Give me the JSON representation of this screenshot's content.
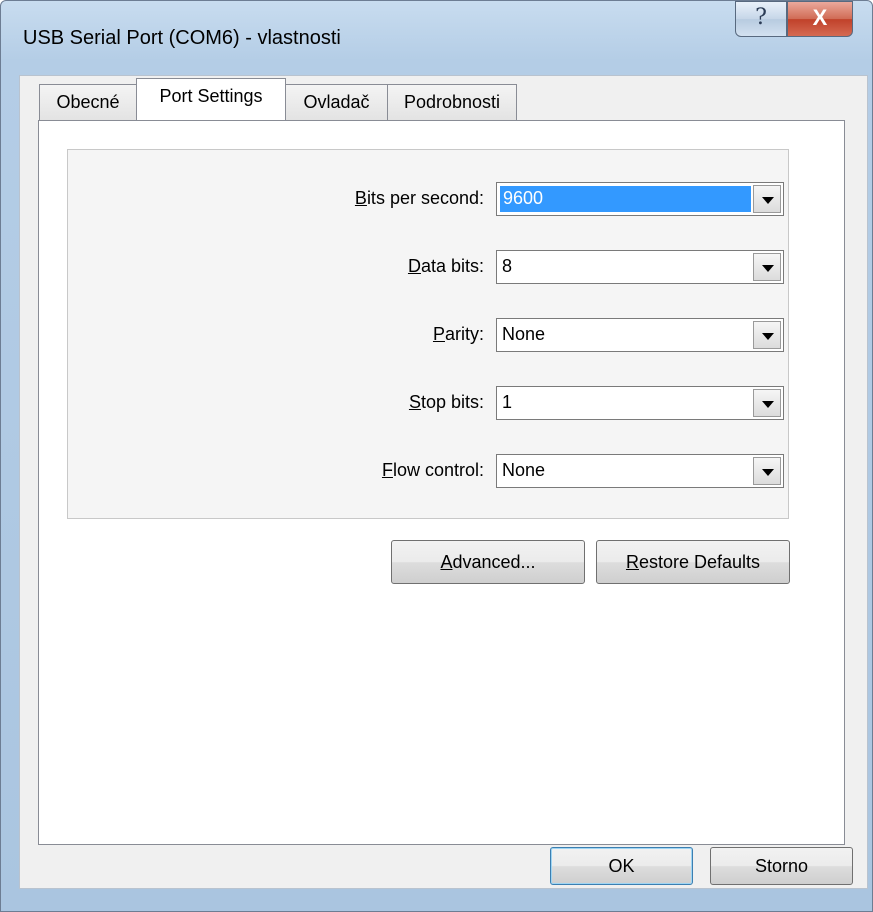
{
  "window": {
    "title": "USB Serial Port (COM6)  - vlastnosti",
    "help_glyph": "?",
    "close_glyph": "X"
  },
  "tabs": [
    {
      "label": "Obecné",
      "active": false
    },
    {
      "label": "Port Settings",
      "active": true
    },
    {
      "label": "Ovladač",
      "active": false
    },
    {
      "label": "Podrobnosti",
      "active": false
    }
  ],
  "settings": {
    "bits_per_second": {
      "label_mnemonic": "B",
      "label_rest": "its per second:",
      "value": "9600"
    },
    "data_bits": {
      "label_mnemonic": "D",
      "label_rest": "ata bits:",
      "value": "8"
    },
    "parity": {
      "label_mnemonic": "P",
      "label_rest": "arity:",
      "value": "None"
    },
    "stop_bits": {
      "label_mnemonic": "S",
      "label_rest": "top bits:",
      "value": "1"
    },
    "flow_control": {
      "label_mnemonic": "F",
      "label_rest": "low control:",
      "value": "None"
    }
  },
  "buttons": {
    "advanced": {
      "mnemonic": "A",
      "rest": "dvanced..."
    },
    "restore_defaults": {
      "mnemonic": "R",
      "rest": "estore Defaults"
    },
    "ok": "OK",
    "cancel": "Storno"
  },
  "colors": {
    "selection": "#3399ff",
    "default_button_border": "#3c7fb1"
  }
}
